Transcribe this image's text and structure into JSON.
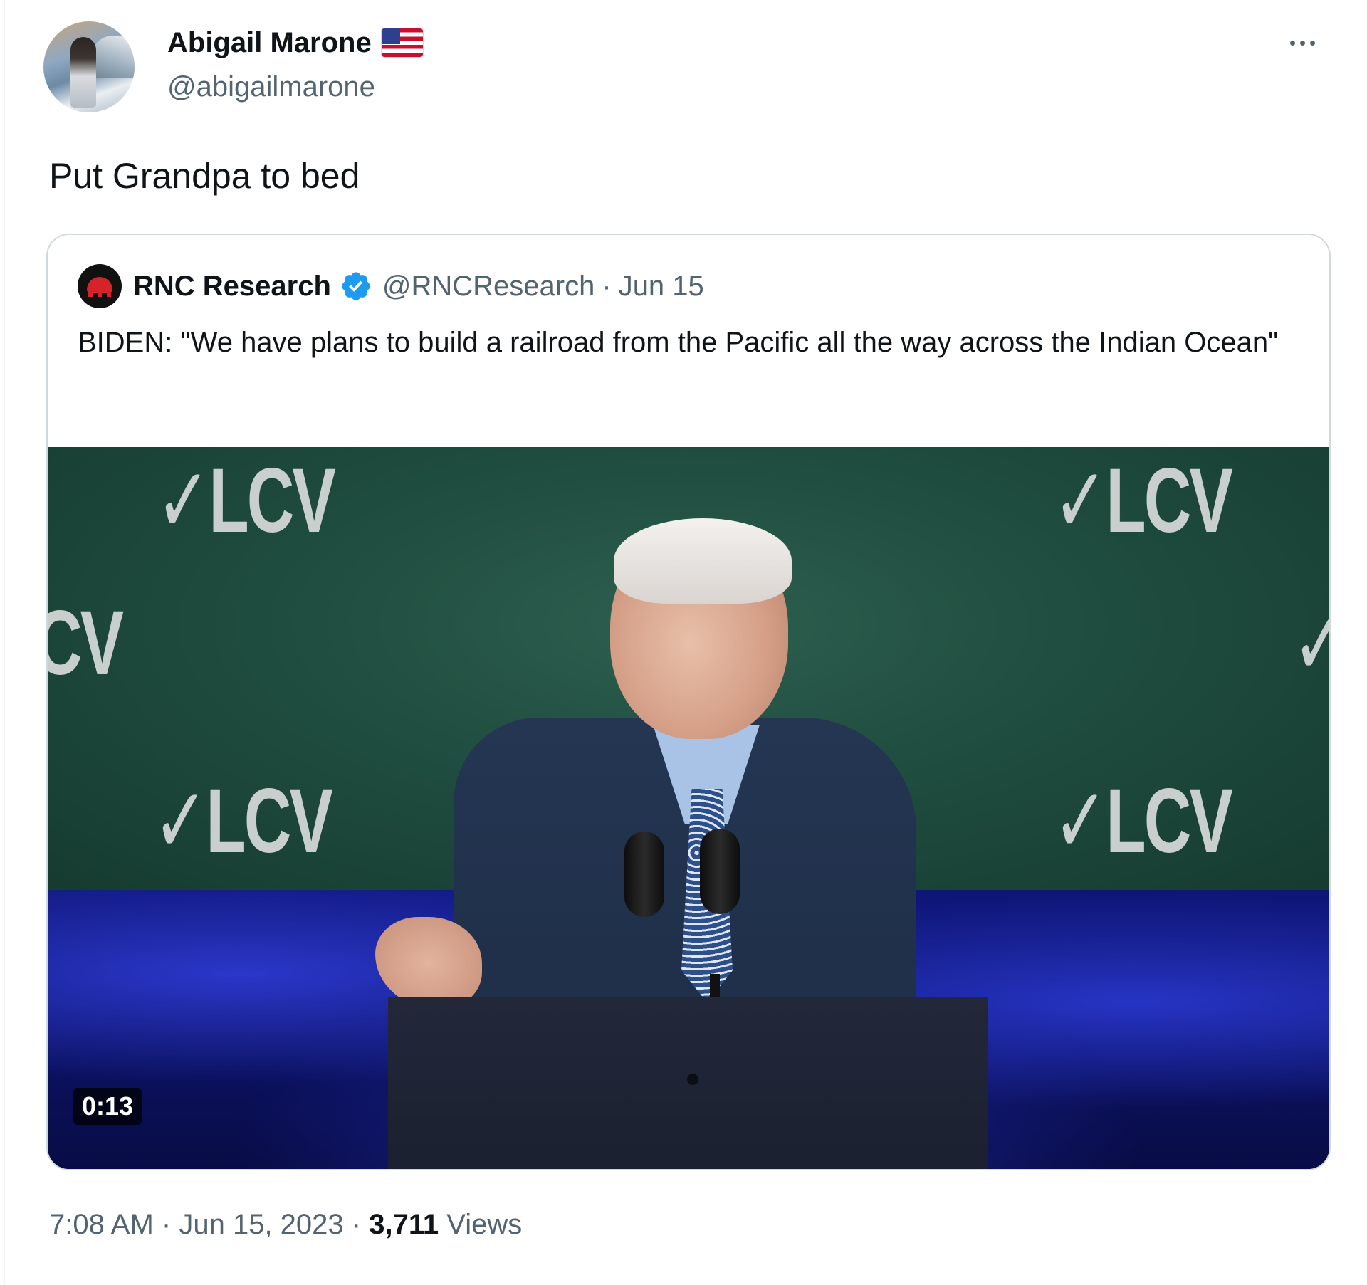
{
  "tweet": {
    "author": {
      "display_name": "Abigail Marone",
      "handle": "@abigailmarone",
      "flag_icon": "us-flag-icon"
    },
    "text": "Put Grandpa to bed",
    "more_icon": "more-horizontal-icon",
    "quoted": {
      "author": {
        "display_name": "RNC Research",
        "handle": "@RNCResearch",
        "verified_icon": "verified-badge-icon",
        "verified_color": "#1d9bf0"
      },
      "separator": "·",
      "date": "Jun 15",
      "text": "BIDEN: \"We have plans to build a railroad from the Pacific all the way across the Indian Ocean\"",
      "video": {
        "duration": "0:13",
        "backdrop_text": [
          "✓LCV",
          "✓LCV",
          "CV",
          "✓",
          "✓LCV",
          "✓LCV"
        ]
      }
    },
    "meta": {
      "time": "7:08 AM",
      "separator1": "·",
      "date": "Jun 15, 2023",
      "separator2": "·",
      "views_count": "3,711",
      "views_label": "Views"
    }
  }
}
